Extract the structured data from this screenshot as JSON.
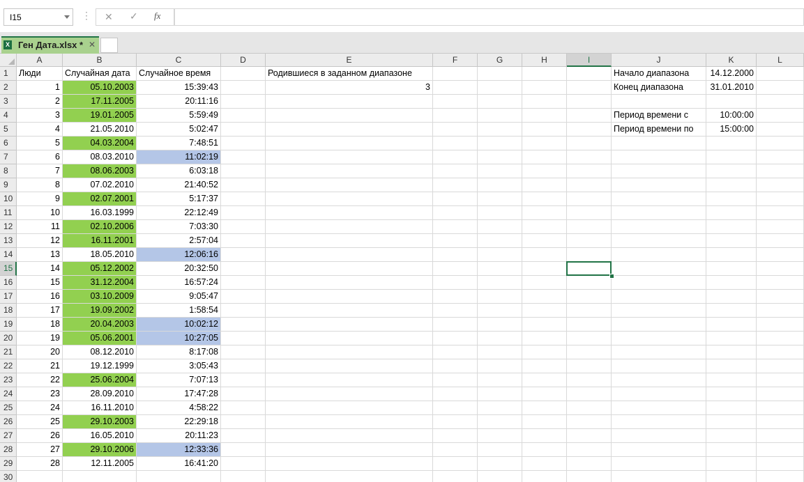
{
  "formula_bar": {
    "name_box": "I15",
    "cancel_icon": "✕",
    "enter_icon": "✓",
    "fx_icon": "fx",
    "formula": ""
  },
  "tabs": {
    "active_file": "Ген Дата.xlsx *",
    "close_icon": "✕",
    "excel_icon": "X"
  },
  "columns": [
    "A",
    "B",
    "C",
    "D",
    "E",
    "F",
    "G",
    "H",
    "I",
    "J",
    "K",
    "L"
  ],
  "selected_cell": "I15",
  "colors": {
    "green_fill": "#92d050",
    "blue_fill": "#b4c6e7",
    "accent": "#217346"
  },
  "headers": {
    "people": "Люди",
    "random_date": "Случайная дата",
    "random_time": "Случайное время",
    "born_in_range": "Родившиеся в заданном диапазоне",
    "born_in_range_count": "3"
  },
  "params": [
    {
      "label": "Начало диапазона",
      "value": "14.12.2000"
    },
    {
      "label": "Конец диапазона",
      "value": "31.01.2010"
    },
    {
      "label": "",
      "value": ""
    },
    {
      "label": "Период времени с",
      "value": "10:00:00"
    },
    {
      "label": "Период времени по",
      "value": "15:00:00"
    }
  ],
  "rows": [
    {
      "n": "1",
      "date": "05.10.2003",
      "time": "15:39:43",
      "date_hl": true,
      "time_hl": false
    },
    {
      "n": "2",
      "date": "17.11.2005",
      "time": "20:11:16",
      "date_hl": true,
      "time_hl": false
    },
    {
      "n": "3",
      "date": "19.01.2005",
      "time": "5:59:49",
      "date_hl": true,
      "time_hl": false
    },
    {
      "n": "4",
      "date": "21.05.2010",
      "time": "5:02:47",
      "date_hl": false,
      "time_hl": false
    },
    {
      "n": "5",
      "date": "04.03.2004",
      "time": "7:48:51",
      "date_hl": true,
      "time_hl": false
    },
    {
      "n": "6",
      "date": "08.03.2010",
      "time": "11:02:19",
      "date_hl": false,
      "time_hl": true
    },
    {
      "n": "7",
      "date": "08.06.2003",
      "time": "6:03:18",
      "date_hl": true,
      "time_hl": false
    },
    {
      "n": "8",
      "date": "07.02.2010",
      "time": "21:40:52",
      "date_hl": false,
      "time_hl": false
    },
    {
      "n": "9",
      "date": "02.07.2001",
      "time": "5:17:37",
      "date_hl": true,
      "time_hl": false
    },
    {
      "n": "10",
      "date": "16.03.1999",
      "time": "22:12:49",
      "date_hl": false,
      "time_hl": false
    },
    {
      "n": "11",
      "date": "02.10.2006",
      "time": "7:03:30",
      "date_hl": true,
      "time_hl": false
    },
    {
      "n": "12",
      "date": "16.11.2001",
      "time": "2:57:04",
      "date_hl": true,
      "time_hl": false
    },
    {
      "n": "13",
      "date": "18.05.2010",
      "time": "12:06:16",
      "date_hl": false,
      "time_hl": true
    },
    {
      "n": "14",
      "date": "05.12.2002",
      "time": "20:32:50",
      "date_hl": true,
      "time_hl": false
    },
    {
      "n": "15",
      "date": "31.12.2004",
      "time": "16:57:24",
      "date_hl": true,
      "time_hl": false
    },
    {
      "n": "16",
      "date": "03.10.2009",
      "time": "9:05:47",
      "date_hl": true,
      "time_hl": false
    },
    {
      "n": "17",
      "date": "19.09.2002",
      "time": "1:58:54",
      "date_hl": true,
      "time_hl": false
    },
    {
      "n": "18",
      "date": "20.04.2003",
      "time": "10:02:12",
      "date_hl": true,
      "time_hl": true
    },
    {
      "n": "19",
      "date": "05.06.2001",
      "time": "10:27:05",
      "date_hl": true,
      "time_hl": true
    },
    {
      "n": "20",
      "date": "08.12.2010",
      "time": "8:17:08",
      "date_hl": false,
      "time_hl": false
    },
    {
      "n": "21",
      "date": "19.12.1999",
      "time": "3:05:43",
      "date_hl": false,
      "time_hl": false
    },
    {
      "n": "22",
      "date": "25.06.2004",
      "time": "7:07:13",
      "date_hl": true,
      "time_hl": false
    },
    {
      "n": "23",
      "date": "28.09.2010",
      "time": "17:47:28",
      "date_hl": false,
      "time_hl": false
    },
    {
      "n": "24",
      "date": "16.11.2010",
      "time": "4:58:22",
      "date_hl": false,
      "time_hl": false
    },
    {
      "n": "25",
      "date": "29.10.2003",
      "time": "22:29:18",
      "date_hl": true,
      "time_hl": false
    },
    {
      "n": "26",
      "date": "16.05.2010",
      "time": "20:11:23",
      "date_hl": false,
      "time_hl": false
    },
    {
      "n": "27",
      "date": "29.10.2006",
      "time": "12:33:36",
      "date_hl": true,
      "time_hl": true
    },
    {
      "n": "28",
      "date": "12.11.2005",
      "time": "16:41:20",
      "date_hl": false,
      "time_hl": false
    }
  ]
}
